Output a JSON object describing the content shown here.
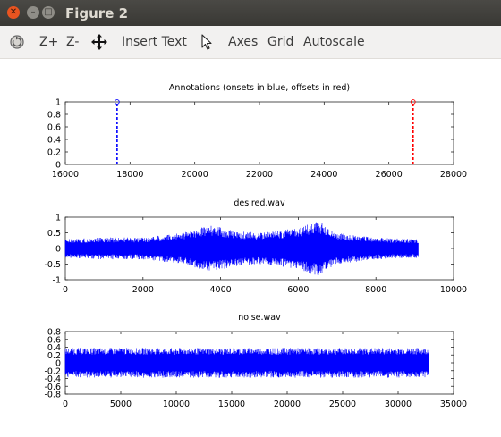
{
  "window": {
    "title": "Figure 2"
  },
  "toolbar": {
    "zoom_in": "Z+",
    "zoom_out": "Z-",
    "insert_text": "Insert Text",
    "axes": "Axes",
    "grid": "Grid",
    "autoscale": "Autoscale"
  },
  "chart_data": [
    {
      "type": "scatter",
      "title": "Annotations (onsets in blue, offsets in red)",
      "xlim": [
        16000,
        28000
      ],
      "ylim": [
        0,
        1
      ],
      "xticks": [
        "16000",
        "18000",
        "20000",
        "22000",
        "24000",
        "26000",
        "28000"
      ],
      "yticks": [
        "0",
        "0.2",
        "0.4",
        "0.6",
        "0.8",
        "1"
      ],
      "series": [
        {
          "values": [
            {
              "x": 17600,
              "y": 1
            }
          ],
          "color": "#0000ff",
          "style": "dashed stem"
        },
        {
          "values": [
            {
              "x": 26750,
              "y": 1
            }
          ],
          "color": "#ff0000",
          "style": "dashed stem"
        }
      ]
    },
    {
      "type": "line",
      "title": "desired.wav",
      "xlim": [
        0,
        10000
      ],
      "ylim": [
        -1,
        1
      ],
      "xticks": [
        "0",
        "2000",
        "4000",
        "6000",
        "8000",
        "10000"
      ],
      "yticks": [
        "-1",
        "-0.5",
        "0",
        "0.5",
        "1"
      ],
      "series": [
        {
          "color": "#0000ff",
          "signal_end_x": 9100,
          "envelope": [
            {
              "x": 0,
              "amp": 0.3
            },
            {
              "x": 1000,
              "amp": 0.35
            },
            {
              "x": 2000,
              "amp": 0.35
            },
            {
              "x": 3000,
              "amp": 0.5
            },
            {
              "x": 3700,
              "amp": 0.75
            },
            {
              "x": 4500,
              "amp": 0.55
            },
            {
              "x": 5000,
              "amp": 0.5
            },
            {
              "x": 6000,
              "amp": 0.65
            },
            {
              "x": 6500,
              "amp": 0.9
            },
            {
              "x": 7000,
              "amp": 0.5
            },
            {
              "x": 8000,
              "amp": 0.35
            },
            {
              "x": 9100,
              "amp": 0.3
            }
          ]
        }
      ]
    },
    {
      "type": "line",
      "title": "noise.wav",
      "xlim": [
        0,
        35000
      ],
      "ylim": [
        -0.8,
        0.8
      ],
      "xticks": [
        "0",
        "5000",
        "10000",
        "15000",
        "20000",
        "25000",
        "30000",
        "35000"
      ],
      "yticks": [
        "-0.8",
        "-0.6",
        "-0.4",
        "-0.2",
        "0",
        "0.2",
        "0.4",
        "0.6",
        "0.8"
      ],
      "series": [
        {
          "color": "#0000ff",
          "signal_end_x": 32768,
          "envelope": [
            {
              "x": 0,
              "amp": 0.38
            },
            {
              "x": 32768,
              "amp": 0.38
            }
          ]
        }
      ]
    }
  ]
}
